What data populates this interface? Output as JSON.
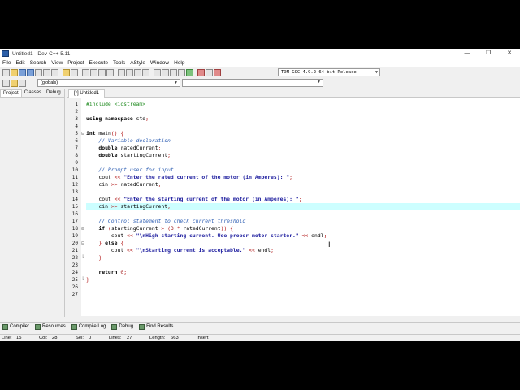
{
  "window": {
    "title": "Untitled1 - Dev-C++ 5.11",
    "controls": [
      "—",
      "❐",
      "✕"
    ]
  },
  "menu": [
    "File",
    "Edit",
    "Search",
    "View",
    "Project",
    "Execute",
    "Tools",
    "AStyle",
    "Window",
    "Help"
  ],
  "toolbar": {
    "compiler": "TDM-GCC 4.9.2 64-bit Release"
  },
  "scope": {
    "value": "(globals)"
  },
  "left_panel": {
    "tabs": [
      "Project",
      "Classes",
      "Debug"
    ],
    "active_tab": "Project"
  },
  "editor": {
    "tab_label": "[*] Untitled1",
    "current_line": 15,
    "lines": [
      {
        "n": "1",
        "code": "#include <iostream>"
      },
      {
        "n": "2",
        "code": ""
      },
      {
        "n": "3",
        "code": "using namespace std;"
      },
      {
        "n": "4",
        "code": ""
      },
      {
        "n": "5",
        "code": "int main() {"
      },
      {
        "n": "6",
        "code": "    // Variable declaration"
      },
      {
        "n": "7",
        "code": "    double ratedCurrent;"
      },
      {
        "n": "8",
        "code": "    double startingCurrent;"
      },
      {
        "n": "9",
        "code": ""
      },
      {
        "n": "10",
        "code": "    // Prompt user for input"
      },
      {
        "n": "11",
        "code": "    cout << \"Enter the rated current of the motor (in Amperes): \";"
      },
      {
        "n": "12",
        "code": "    cin >> ratedCurrent;"
      },
      {
        "n": "13",
        "code": ""
      },
      {
        "n": "14",
        "code": "    cout << \"Enter the starting current of the motor (in Amperes): \";"
      },
      {
        "n": "15",
        "code": "    cin >> startingCurrent;"
      },
      {
        "n": "16",
        "code": ""
      },
      {
        "n": "17",
        "code": "    // Control statement to check current threshold"
      },
      {
        "n": "18",
        "code": "    if (startingCurrent > (3 * ratedCurrent)) {"
      },
      {
        "n": "19",
        "code": "        cout << \"\\nHigh starting current. Use proper motor starter.\" << endl;"
      },
      {
        "n": "20",
        "code": "    } else {"
      },
      {
        "n": "21",
        "code": "        cout << \"\\nStarting current is acceptable.\" << endl;"
      },
      {
        "n": "22",
        "code": "    }"
      },
      {
        "n": "23",
        "code": ""
      },
      {
        "n": "24",
        "code": "    return 0;"
      },
      {
        "n": "25",
        "code": "}"
      },
      {
        "n": "26",
        "code": ""
      },
      {
        "n": "27",
        "code": ""
      }
    ]
  },
  "bottom_tabs": [
    {
      "label": "Compiler",
      "icon": "compiler-icon"
    },
    {
      "label": "Resources",
      "icon": "resources-icon"
    },
    {
      "label": "Compile Log",
      "icon": "compile-log-icon"
    },
    {
      "label": "Debug",
      "icon": "debug-icon"
    },
    {
      "label": "Find Results",
      "icon": "find-results-icon"
    }
  ],
  "status": {
    "line_label": "Line:",
    "line_value": "15",
    "col_label": "Col:",
    "col_value": "28",
    "sel_label": "Sel:",
    "sel_value": "0",
    "lines_label": "Lines:",
    "lines_value": "27",
    "length_label": "Length:",
    "length_value": "663",
    "mode": "Insert"
  },
  "colors": {
    "current_line": "#ccfeff",
    "comment": "#2f5fb3",
    "string": "#1c1c9e",
    "number": "#9c1010",
    "preprocessor": "#1e8a1e"
  }
}
